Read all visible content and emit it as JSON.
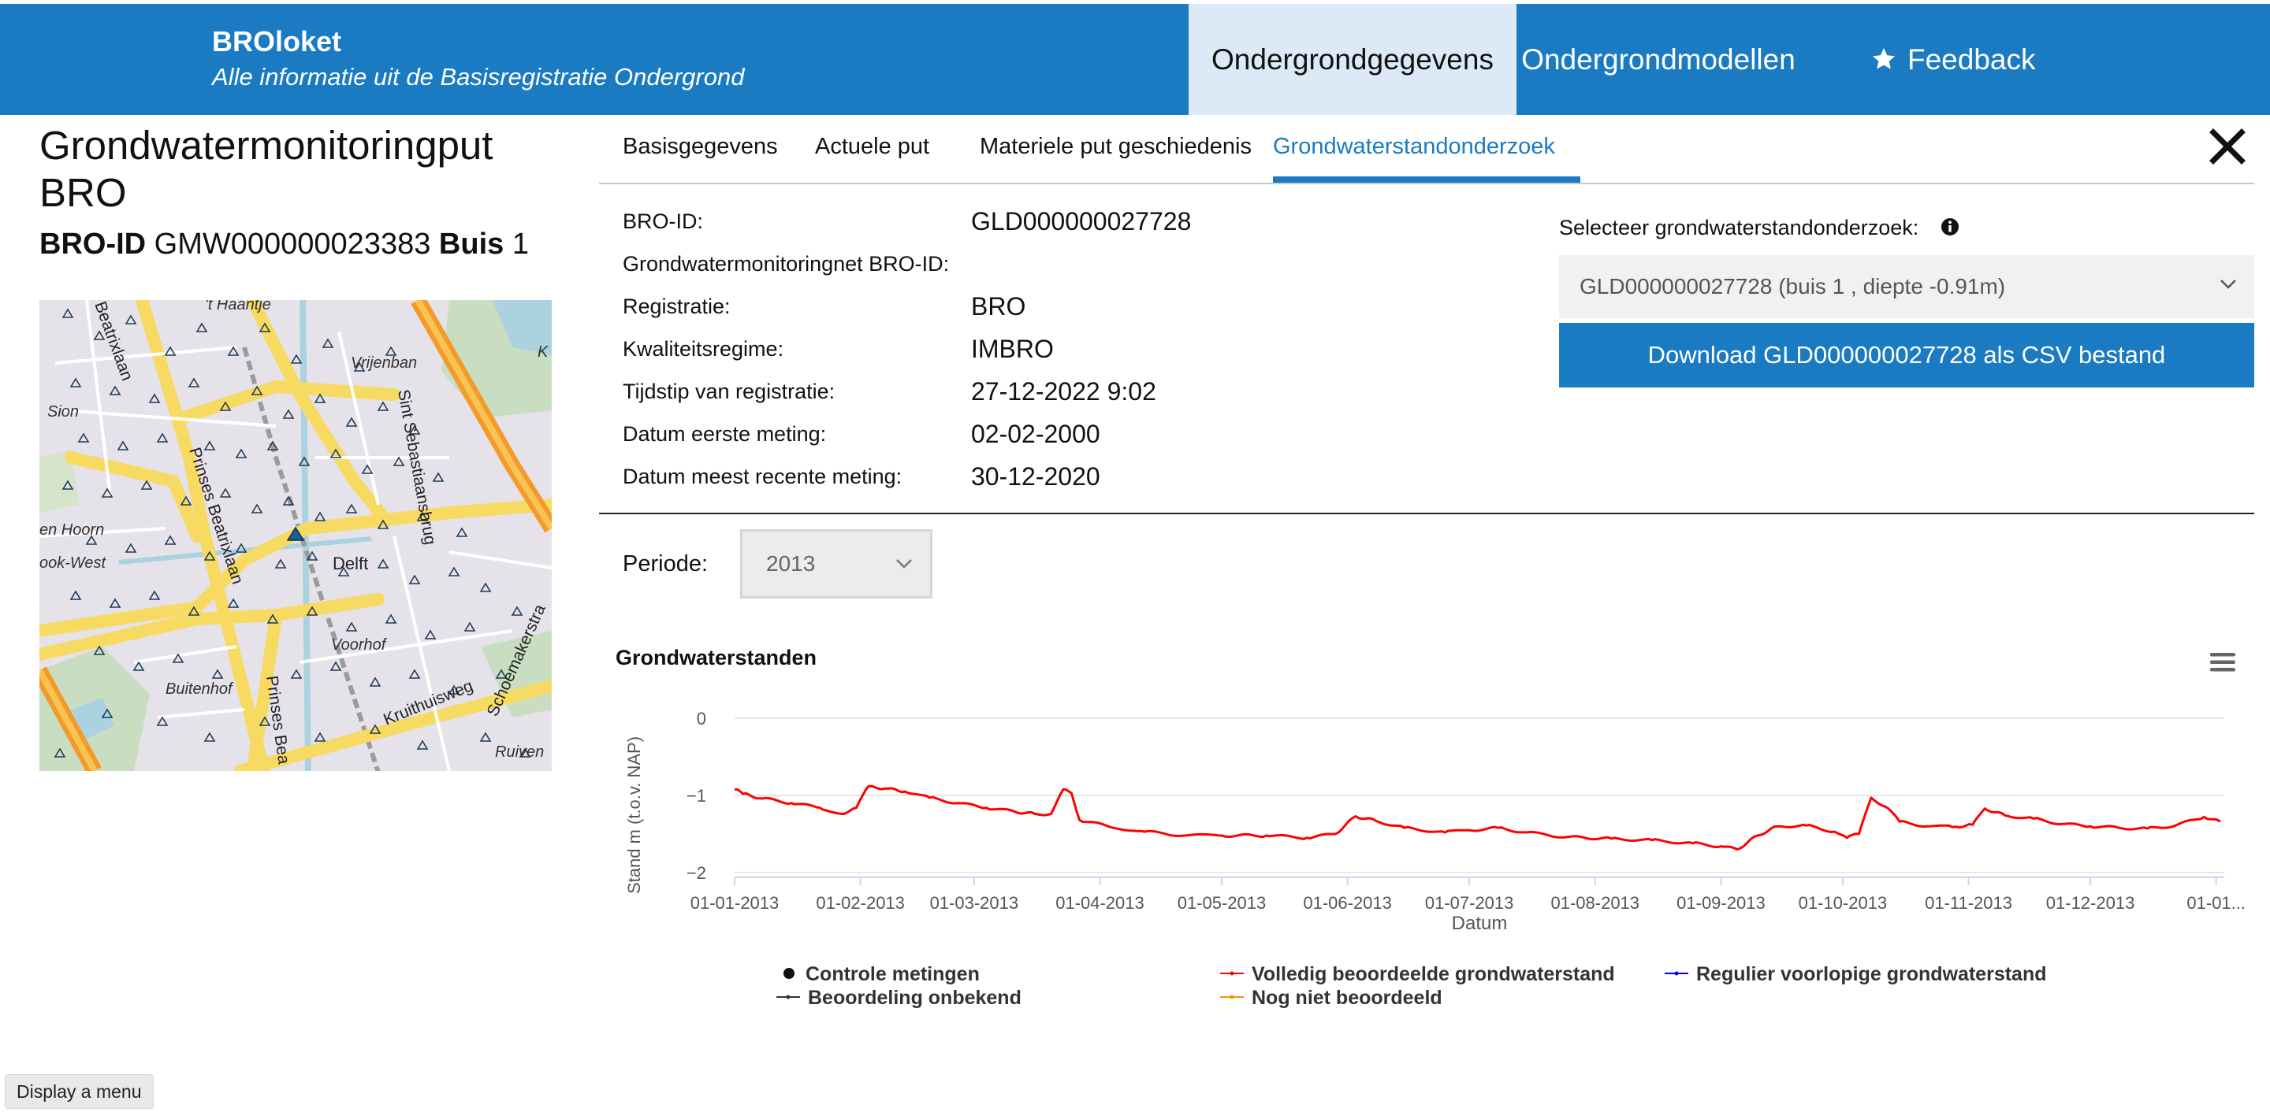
{
  "header": {
    "brand_title": "BROloket",
    "brand_subtitle": "Alle informatie uit de Basisregistratie Ondergrond",
    "nav": {
      "ondergrondgegevens": "Ondergrondgegevens",
      "ondergrondmodellen": "Ondergrondmodellen",
      "feedback": "Feedback"
    }
  },
  "page": {
    "title": "Grondwatermonitoringput BRO",
    "bro_id_label": "BRO-ID",
    "bro_id_value": "GMW000000023383",
    "buis_label": "Buis",
    "buis_value": "1"
  },
  "map": {
    "labels": {
      "haantje": "'t Haantje",
      "vrijenban": "Vrijenban",
      "sion": "Sion",
      "prinses_beatrixlaan": "Prinses Beatrixlaan",
      "beatrixlaan_top": "Beatrixlaan",
      "sint_sebastiaansbrug": "Sint Sebastiaansbrug",
      "den_hoorn": "en Hoorn",
      "hoek_west": "ook-West",
      "delft": "Delft",
      "voorhof": "Voorhof",
      "buitenhof": "Buitenhof",
      "prinses_bea": "Prinses Bea",
      "kruithuisweg": "Kruithuisweg",
      "schoemakerstraat": "Schoemakerstra",
      "ruiven": "Ruiven",
      "k": "K"
    }
  },
  "tabs": [
    {
      "label": "Basisgegevens",
      "active": false
    },
    {
      "label": "Actuele put",
      "active": false
    },
    {
      "label": "Materiele put geschiedenis",
      "active": false
    },
    {
      "label": "Grondwaterstandonderzoek",
      "active": true
    }
  ],
  "details": {
    "bro_id": {
      "label": "BRO-ID:",
      "value": "GLD000000027728"
    },
    "net": {
      "label": "Grondwatermonitoringnet BRO-ID:",
      "value": ""
    },
    "registratie": {
      "label": "Registratie:",
      "value": "BRO"
    },
    "kwaliteit": {
      "label": "Kwaliteitsregime:",
      "value": "IMBRO"
    },
    "tijdstip": {
      "label": "Tijdstip van registratie:",
      "value": "27-12-2022 9:02"
    },
    "eerste": {
      "label": "Datum eerste meting:",
      "value": "02-02-2000"
    },
    "recent": {
      "label": "Datum meest recente meting:",
      "value": "30-12-2020"
    }
  },
  "panel": {
    "select_label": "Selecteer grondwaterstandonderzoek:",
    "select_value": "GLD000000027728 (buis 1 , diepte -0.91m)",
    "download_label": "Download GLD000000027728 als CSV bestand"
  },
  "periode": {
    "label": "Periode:",
    "value": "2013"
  },
  "colors": {
    "brand": "#1a7bc2",
    "nav_active_bg": "#dbeaf6",
    "series_volledig": "#ff0000",
    "series_regulier": "#0000ff",
    "series_onbekend": "#333333",
    "series_niet": "#ff8c00"
  },
  "legend": {
    "controle": "Controle metingen",
    "volledig": "Volledig beoordeelde grondwaterstand",
    "regulier": "Regulier voorlopige grondwaterstand",
    "onbekend": "Beoordeling onbekend",
    "niet": "Nog niet beoordeeld"
  },
  "footer": {
    "display_menu": "Display a menu"
  },
  "chart_data": {
    "type": "line",
    "title": "Grondwaterstanden",
    "xlabel": "Datum",
    "ylabel": "Stand m (t.o.v. NAP)",
    "ylim": [
      -2,
      0
    ],
    "y_ticks": [
      "0",
      "−1",
      "−2"
    ],
    "x_ticks": [
      "01-01-2013",
      "01-02-2013",
      "01-03-2013",
      "01-04-2013",
      "01-05-2013",
      "01-06-2013",
      "01-07-2013",
      "01-08-2013",
      "01-09-2013",
      "01-10-2013",
      "01-11-2013",
      "01-12-2013",
      "01-01..."
    ],
    "grid": true,
    "legend_position": "bottom",
    "series": [
      {
        "name": "Volledig beoordeelde grondwaterstand",
        "color": "#ff0000",
        "x": [
          "2013-01-01",
          "2013-01-03",
          "2013-01-08",
          "2013-01-15",
          "2013-01-22",
          "2013-01-28",
          "2013-01-31",
          "2013-02-03",
          "2013-02-07",
          "2013-02-12",
          "2013-02-18",
          "2013-02-25",
          "2013-03-04",
          "2013-03-11",
          "2013-03-16",
          "2013-03-20",
          "2013-03-23",
          "2013-03-25",
          "2013-03-27",
          "2013-04-03",
          "2013-04-12",
          "2013-04-22",
          "2013-05-01",
          "2013-05-12",
          "2013-05-22",
          "2013-05-29",
          "2013-06-03",
          "2013-06-08",
          "2013-06-15",
          "2013-06-25",
          "2013-07-01",
          "2013-07-08",
          "2013-07-15",
          "2013-07-25",
          "2013-08-05",
          "2013-08-15",
          "2013-08-25",
          "2013-09-01",
          "2013-09-05",
          "2013-09-10",
          "2013-09-15",
          "2013-09-22",
          "2013-09-29",
          "2013-10-02",
          "2013-10-05",
          "2013-10-08",
          "2013-10-12",
          "2013-10-15",
          "2013-10-22",
          "2013-10-28",
          "2013-11-02",
          "2013-11-05",
          "2013-11-10",
          "2013-11-17",
          "2013-11-24",
          "2013-12-01",
          "2013-12-08",
          "2013-12-15",
          "2013-12-22",
          "2013-12-29",
          "2014-01-02"
        ],
        "values": [
          -0.92,
          -0.98,
          -1.04,
          -1.1,
          -1.16,
          -1.24,
          -1.16,
          -0.88,
          -0.91,
          -0.95,
          -1.03,
          -1.1,
          -1.16,
          -1.21,
          -1.24,
          -1.24,
          -0.92,
          -0.97,
          -1.32,
          -1.4,
          -1.47,
          -1.52,
          -1.52,
          -1.52,
          -1.55,
          -1.5,
          -1.27,
          -1.33,
          -1.42,
          -1.48,
          -1.45,
          -1.42,
          -1.48,
          -1.54,
          -1.56,
          -1.58,
          -1.62,
          -1.66,
          -1.7,
          -1.52,
          -1.4,
          -1.39,
          -1.47,
          -1.55,
          -1.5,
          -1.03,
          -1.16,
          -1.34,
          -1.4,
          -1.41,
          -1.38,
          -1.17,
          -1.26,
          -1.3,
          -1.37,
          -1.4,
          -1.42,
          -1.43,
          -1.39,
          -1.28,
          -1.34
        ]
      }
    ]
  }
}
